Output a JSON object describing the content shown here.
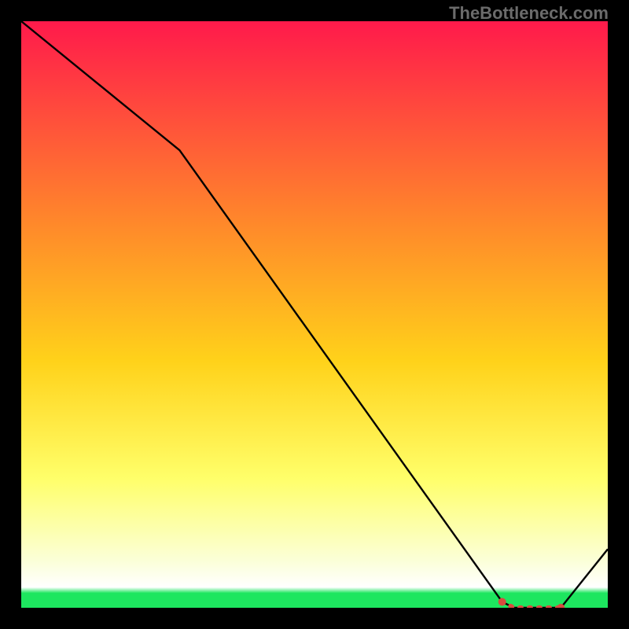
{
  "attribution": "TheBottleneck.com",
  "colors": {
    "top": "#ff1a4b",
    "mid_upper": "#ff8a2a",
    "mid": "#ffd21a",
    "mid_lower": "#ffff6a",
    "pale": "#fbffd8",
    "green": "#1de65f",
    "frame": "#000000",
    "line": "#000000",
    "markers": "#d84b3f"
  },
  "chart_data": {
    "type": "line",
    "title": "",
    "xlabel": "",
    "ylabel": "",
    "xlim": [
      0,
      100
    ],
    "ylim": [
      0,
      100
    ],
    "x": [
      0,
      27,
      82,
      84,
      86,
      88,
      90,
      91,
      92,
      100
    ],
    "values": [
      100,
      78,
      1,
      0,
      0,
      0,
      0,
      0,
      0,
      10
    ],
    "marker_x": [
      82,
      84,
      86,
      88,
      90,
      91,
      92
    ],
    "marker_values": [
      1,
      0,
      0,
      0,
      0,
      0,
      0
    ]
  }
}
